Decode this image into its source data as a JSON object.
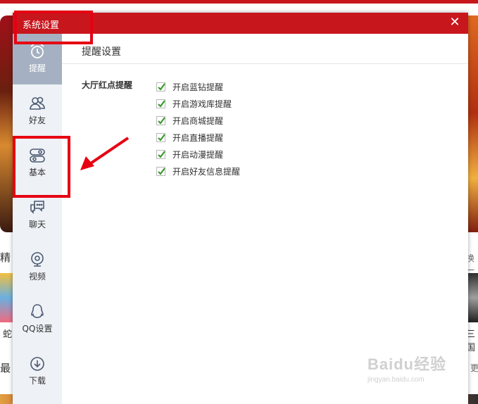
{
  "dialog": {
    "title": "系统设置",
    "close_icon": "close-icon"
  },
  "sidebar": {
    "items": [
      {
        "label": "提醒",
        "icon": "alarm-clock-icon",
        "active": true
      },
      {
        "label": "好友",
        "icon": "friends-icon",
        "active": false
      },
      {
        "label": "基本",
        "icon": "toggle-switch-icon",
        "active": false
      },
      {
        "label": "聊天",
        "icon": "chat-bubble-icon",
        "active": false
      },
      {
        "label": "视频",
        "icon": "webcam-icon",
        "active": false
      },
      {
        "label": "QQ设置",
        "icon": "qq-penguin-icon",
        "active": false
      },
      {
        "label": "下载",
        "icon": "download-icon",
        "active": false
      }
    ]
  },
  "content": {
    "section_title": "提醒设置",
    "group_label": "大厅红点提醒",
    "options": [
      {
        "label": "开启蓝钻提醒",
        "checked": true
      },
      {
        "label": "开启游戏库提醒",
        "checked": true
      },
      {
        "label": "开启商城提醒",
        "checked": true
      },
      {
        "label": "开启直播提醒",
        "checked": true
      },
      {
        "label": "开启动漫提醒",
        "checked": true
      },
      {
        "label": "开启好友信息提醒",
        "checked": true
      }
    ]
  },
  "background": {
    "left_fragments": [
      "精",
      "蛇",
      "最"
    ],
    "right_fragments": [
      "换一",
      "三国",
      "更"
    ]
  },
  "watermark": {
    "main": "Baidu经验",
    "sub": "jingyan.baidu.com"
  },
  "colors": {
    "titlebar": "#c8161d",
    "sidebar_active": "#a5b1c2",
    "checkbox_check": "#3a9a2c",
    "annotation": "#e60012"
  }
}
